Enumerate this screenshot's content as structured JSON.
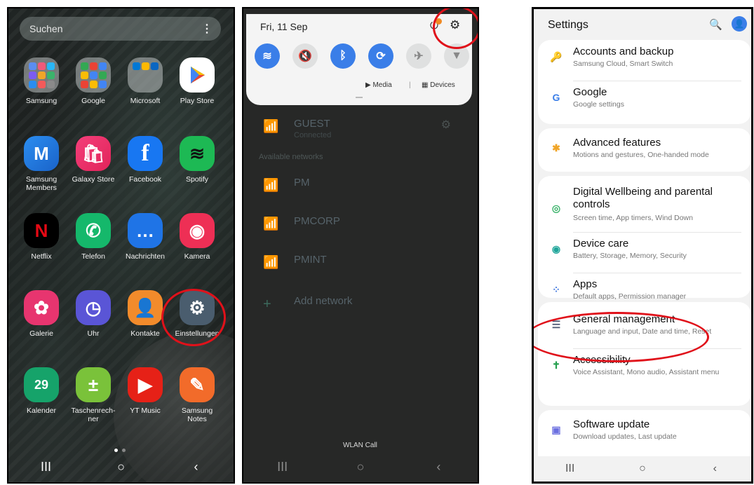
{
  "home": {
    "search_placeholder": "Suchen",
    "apps": [
      {
        "label": "Samsung",
        "icon": "samsung-folder-icon"
      },
      {
        "label": "Google",
        "icon": "google-folder-icon"
      },
      {
        "label": "Microsoft",
        "icon": "microsoft-folder-icon"
      },
      {
        "label": "Play Store",
        "icon": "play-store-icon"
      },
      {
        "label": "Samsung Members",
        "icon": "samsung-members-icon",
        "glyph": "M"
      },
      {
        "label": "Galaxy Store",
        "icon": "galaxy-store-icon",
        "glyph": "🛍"
      },
      {
        "label": "Facebook",
        "icon": "facebook-icon",
        "glyph": "f"
      },
      {
        "label": "Spotify",
        "icon": "spotify-icon",
        "glyph": "≋"
      },
      {
        "label": "Netflix",
        "icon": "netflix-icon",
        "glyph": "N"
      },
      {
        "label": "Telefon",
        "icon": "phone-icon",
        "glyph": "✆"
      },
      {
        "label": "Nachrichten",
        "icon": "messages-icon",
        "glyph": "…"
      },
      {
        "label": "Kamera",
        "icon": "camera-icon",
        "glyph": "◉"
      },
      {
        "label": "Galerie",
        "icon": "gallery-icon",
        "glyph": "✿"
      },
      {
        "label": "Uhr",
        "icon": "clock-icon",
        "glyph": "◷"
      },
      {
        "label": "Kontakte",
        "icon": "contacts-icon",
        "glyph": "👤"
      },
      {
        "label": "Einstellungen",
        "icon": "settings-gear-icon",
        "glyph": "⚙"
      },
      {
        "label": "Kalender",
        "icon": "calendar-icon",
        "glyph": "29"
      },
      {
        "label": "Taschenrech-ner",
        "icon": "calculator-icon",
        "glyph": "±"
      },
      {
        "label": "YT Music",
        "icon": "yt-music-icon",
        "glyph": "▶"
      },
      {
        "label": "Samsung Notes",
        "icon": "samsung-notes-icon",
        "glyph": "✎"
      }
    ],
    "nav": {
      "recents": "III",
      "home": "○",
      "back": "‹"
    }
  },
  "quick_panel": {
    "date": "Fri, 11 Sep",
    "media_label": "Media",
    "separator": "|",
    "devices_label": "Devices",
    "connected_network": {
      "name": "GUEST",
      "status": "Connected"
    },
    "available_label": "Available networks",
    "networks": [
      "PM",
      "PMCORP",
      "PMINT"
    ],
    "add_network": "Add network",
    "wlan_call": "WLAN Call",
    "tiles": [
      {
        "icon": "wifi-icon",
        "on": true,
        "glyph": "≋"
      },
      {
        "icon": "mute-icon",
        "on": false,
        "glyph": "🔇"
      },
      {
        "icon": "bluetooth-icon",
        "on": true,
        "glyph": "ᛒ"
      },
      {
        "icon": "auto-rotate-icon",
        "on": true,
        "glyph": "⟳"
      },
      {
        "icon": "airplane-icon",
        "on": false,
        "glyph": "✈"
      },
      {
        "icon": "flashlight-icon",
        "on": false,
        "glyph": "▼"
      }
    ]
  },
  "settings": {
    "title": "Settings",
    "items": [
      {
        "title": "Accounts and backup",
        "subtitle": "Samsung Cloud, Smart Switch",
        "icon": "key-icon",
        "color": "#3a63c9"
      },
      {
        "title": "Google",
        "subtitle": "Google settings",
        "icon": "google-g-icon",
        "color": "#3a7ee8"
      },
      {
        "title": "Advanced features",
        "subtitle": "Motions and gestures, One-handed mode",
        "icon": "advanced-gear-icon",
        "color": "#f0a528"
      },
      {
        "title": "Digital Wellbeing and parental controls",
        "subtitle": "Screen time, App timers, Wind Down",
        "icon": "wellbeing-icon",
        "color": "#3bb36b"
      },
      {
        "title": "Device care",
        "subtitle": "Battery, Storage, Memory, Security",
        "icon": "device-care-icon",
        "color": "#1fa59a"
      },
      {
        "title": "Apps",
        "subtitle": "Default apps, Permission manager",
        "icon": "apps-grid-icon",
        "color": "#4a7ee0"
      },
      {
        "title": "General management",
        "subtitle": "Language and input, Date and time, Reset",
        "icon": "sliders-icon",
        "color": "#55607a"
      },
      {
        "title": "Accessibility",
        "subtitle": "Voice Assistant, Mono audio, Assistant menu",
        "icon": "accessibility-icon",
        "color": "#26a04f"
      },
      {
        "title": "Software update",
        "subtitle": "Download updates, Last update",
        "icon": "software-update-icon",
        "color": "#6b6fe0"
      }
    ]
  }
}
